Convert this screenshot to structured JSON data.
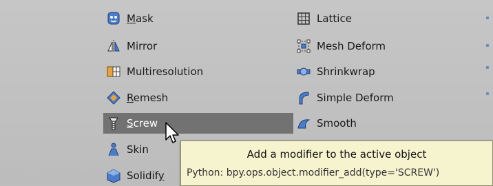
{
  "menu": {
    "left_column": [
      {
        "name_id": "mask",
        "label": "Mask",
        "underline": "M",
        "rest": "ask",
        "icon": "mask-icon"
      },
      {
        "name_id": "mirror",
        "label": "Mirror",
        "icon": "mirror-icon"
      },
      {
        "name_id": "multiresolution",
        "label": "Multiresolution",
        "icon": "multiresolution-icon"
      },
      {
        "name_id": "remesh",
        "label": "Remesh",
        "underline": "R",
        "rest": "emesh",
        "icon": "remesh-icon"
      },
      {
        "name_id": "screw",
        "label": "Screw",
        "underline": "S",
        "rest": "crew",
        "icon": "screw-icon",
        "selected": true
      },
      {
        "name_id": "skin",
        "label": "Skin",
        "icon": "skin-icon"
      },
      {
        "name_id": "solidify",
        "label": "Solidify",
        "pre": "Solidif",
        "underline": "y",
        "icon": "solidify-icon"
      }
    ],
    "right_column": [
      {
        "name_id": "lattice",
        "label": "Lattice",
        "icon": "lattice-icon"
      },
      {
        "name_id": "mesh-deform",
        "label": "Mesh Deform",
        "icon": "mesh-deform-icon"
      },
      {
        "name_id": "shrinkwrap",
        "label": "Shrinkwrap",
        "icon": "shrinkwrap-icon"
      },
      {
        "name_id": "simple-deform",
        "label": "Simple Deform",
        "icon": "simple-deform-icon"
      },
      {
        "name_id": "smooth",
        "label": "Smooth",
        "icon": "smooth-icon"
      }
    ]
  },
  "tooltip": {
    "description": "Add a modifier to the active object",
    "python": "Python: bpy.ops.object.modifier_add(type='SCREW')"
  },
  "colors": {
    "selected_bg": "#727272",
    "tooltip_bg": "#f6f3cf",
    "menu_bg": "#c0c0c0"
  }
}
